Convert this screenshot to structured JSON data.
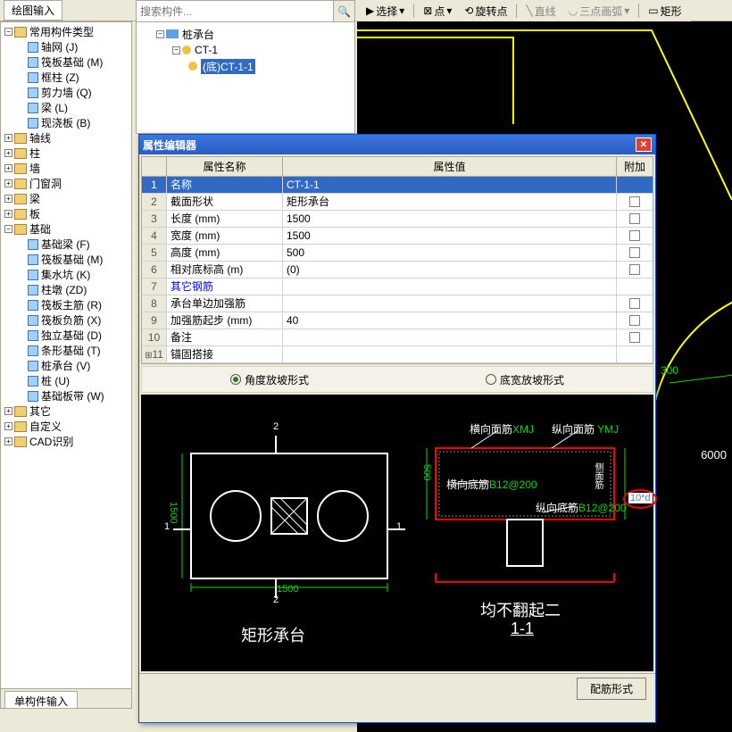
{
  "topTab": "绘图输入",
  "toolbar": {
    "select": "选择",
    "point": "点",
    "rotate": "旋转点",
    "line": "直线",
    "arc": "三点画弧",
    "rect": "矩形"
  },
  "leftTree": {
    "root": "常用构件类型",
    "items": [
      "轴网 (J)",
      "筏板基础 (M)",
      "框柱 (Z)",
      "剪力墙 (Q)",
      "梁 (L)",
      "现浇板 (B)"
    ],
    "folders": [
      "轴线",
      "柱",
      "墙",
      "门窗洞",
      "梁",
      "板"
    ],
    "foundation": "基础",
    "foundationItems": [
      "基础梁 (F)",
      "筏板基础 (M)",
      "集水坑 (K)",
      "柱墩 (ZD)",
      "筏板主筋 (R)",
      "筏板负筋 (X)",
      "独立基础 (D)",
      "条形基础 (T)",
      "桩承台 (V)",
      "桩 (U)",
      "基础板带 (W)"
    ],
    "tailFolders": [
      "其它",
      "自定义",
      "CAD识别"
    ],
    "bottomTab": "单构件输入"
  },
  "midPanel": {
    "searchPlaceholder": "搜索构件...",
    "tree": {
      "root": "桩承台",
      "child": "CT-1",
      "leaf": "(底)CT-1-1"
    }
  },
  "dialog": {
    "title": "属性编辑器",
    "headers": {
      "name": "属性名称",
      "value": "属性值",
      "extra": "附加"
    },
    "rows": [
      {
        "idx": "1",
        "name": "名称",
        "val": "CT-1-1",
        "sel": true,
        "chk": false
      },
      {
        "idx": "2",
        "name": "截面形状",
        "val": "矩形承台",
        "chk": true
      },
      {
        "idx": "3",
        "name": "长度 (mm)",
        "val": "1500",
        "chk": true
      },
      {
        "idx": "4",
        "name": "宽度 (mm)",
        "val": "1500",
        "chk": true
      },
      {
        "idx": "5",
        "name": "高度 (mm)",
        "val": "500",
        "chk": true
      },
      {
        "idx": "6",
        "name": "相对底标高 (m)",
        "val": "(0)",
        "chk": true
      },
      {
        "idx": "7",
        "name": "其它钢筋",
        "val": "",
        "blue": true,
        "chk": false
      },
      {
        "idx": "8",
        "name": "承台单边加强筋",
        "val": "",
        "chk": true
      },
      {
        "idx": "9",
        "name": "加强筋起步 (mm)",
        "val": "40",
        "chk": true
      },
      {
        "idx": "10",
        "name": "备注",
        "val": "",
        "chk": true
      },
      {
        "idx": "11",
        "name": "锚固搭接",
        "val": "",
        "plus": true,
        "chk": false
      }
    ],
    "radio1": "角度放坡形式",
    "radio2": "底宽放坡形式",
    "diagram": {
      "leftTitle": "矩形承台",
      "len": "1500",
      "h": "1500",
      "s500": "500",
      "rightTitle1": "均不翻起二",
      "rightTitle2": "1-1",
      "hxmj": "横向面筋",
      "xmj": "XMJ",
      "zxmj": "纵向面筋",
      "ymj": "YMJ",
      "hxdj": "横向底筋",
      "hxdjv": "B12@200",
      "zxdj": "纵向底筋",
      "zxdjv": "B12@200",
      "cmj": "侧面筋",
      "ten_d": "10*d"
    },
    "bottomBtn": "配筋形式"
  },
  "cad": {
    "dim6000": "6000"
  }
}
